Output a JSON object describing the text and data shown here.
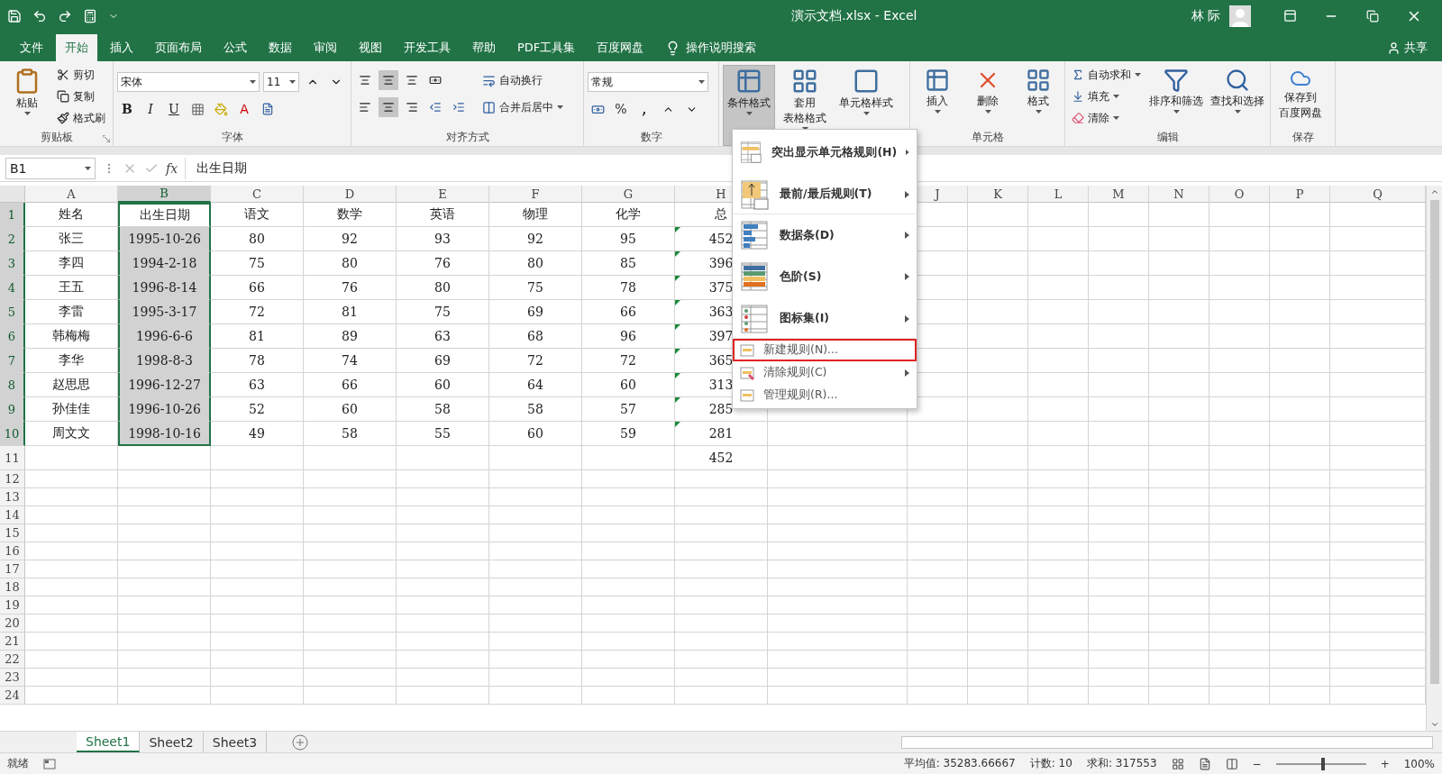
{
  "title_bar": {
    "title": "演示文档.xlsx  -  Excel",
    "user": "林 际"
  },
  "menu_tabs": [
    {
      "label": "文件",
      "selected": false
    },
    {
      "label": "开始",
      "selected": true
    },
    {
      "label": "插入",
      "selected": false
    },
    {
      "label": "页面布局",
      "selected": false
    },
    {
      "label": "公式",
      "selected": false
    },
    {
      "label": "数据",
      "selected": false
    },
    {
      "label": "审阅",
      "selected": false
    },
    {
      "label": "视图",
      "selected": false
    },
    {
      "label": "开发工具",
      "selected": false
    },
    {
      "label": "帮助",
      "selected": false
    },
    {
      "label": "PDF工具集",
      "selected": false
    },
    {
      "label": "百度网盘",
      "selected": false
    }
  ],
  "tell_me": "操作说明搜索",
  "share": "共享",
  "ribbon": {
    "clipboard": {
      "label": "剪贴板",
      "paste": "粘贴",
      "items": [
        "剪切",
        "复制",
        "格式刷"
      ]
    },
    "font": {
      "label": "字体",
      "font_name": "宋体",
      "font_size": "11",
      "bold": "B",
      "italic": "I",
      "underline": "U",
      "font_color": "A"
    },
    "alignment": {
      "label": "对齐方式",
      "wrap": "自动换行",
      "merge": "合并后居中"
    },
    "number": {
      "label": "数字",
      "format": "常规",
      "percent": "%",
      "comma": ","
    },
    "styles": {
      "buttons": [
        {
          "lines": [
            "条件格式"
          ],
          "selected": true
        },
        {
          "lines": [
            "套用",
            "表格格式"
          ],
          "selected": false
        },
        {
          "lines": [
            "单元格样式"
          ],
          "selected": false
        }
      ]
    },
    "cells": {
      "label": "单元格",
      "buttons": [
        "插入",
        "删除",
        "格式"
      ]
    },
    "editing": {
      "label": "编辑",
      "small": [
        "自动求和",
        "填充",
        "清除"
      ],
      "large": [
        "排序和筛选",
        "查找和选择"
      ]
    },
    "save": {
      "label": "保存",
      "button": [
        "保存到",
        "百度网盘"
      ]
    }
  },
  "formula_bar": {
    "name_box": "B1",
    "function_label": "fx",
    "formula": "出生日期"
  },
  "sheet": {
    "columns": [
      {
        "label": "A",
        "selected": false
      },
      {
        "label": "B",
        "selected": true
      },
      {
        "label": "C",
        "selected": false
      },
      {
        "label": "D",
        "selected": false
      },
      {
        "label": "E",
        "selected": false
      },
      {
        "label": "F",
        "selected": false
      },
      {
        "label": "G",
        "selected": false
      },
      {
        "label": "H",
        "selected": false
      },
      {},
      {
        "label": "J",
        "selected": false
      },
      {
        "label": "K",
        "selected": false
      },
      {
        "label": "L",
        "selected": false
      },
      {
        "label": "M",
        "selected": false
      },
      {
        "label": "N",
        "selected": false
      },
      {
        "label": "O",
        "selected": false
      },
      {
        "label": "P",
        "selected": false
      },
      {
        "label": "Q",
        "selected": false
      }
    ],
    "rows": [
      {
        "number": "1",
        "selected": true,
        "flagged": false,
        "cells": [
          "姓名",
          "出生日期",
          "语文",
          "数学",
          "英语",
          "物理",
          "化学",
          "总"
        ]
      },
      {
        "number": "2",
        "selected": true,
        "flagged": true,
        "cells": [
          "张三",
          "1995-10-26",
          "80",
          "92",
          "93",
          "92",
          "95",
          "452"
        ]
      },
      {
        "number": "3",
        "selected": true,
        "flagged": true,
        "cells": [
          "李四",
          "1994-2-18",
          "75",
          "80",
          "76",
          "80",
          "85",
          "396"
        ]
      },
      {
        "number": "4",
        "selected": true,
        "flagged": true,
        "cells": [
          "王五",
          "1996-8-14",
          "66",
          "76",
          "80",
          "75",
          "78",
          "375"
        ]
      },
      {
        "number": "5",
        "selected": true,
        "flagged": true,
        "cells": [
          "李雷",
          "1995-3-17",
          "72",
          "81",
          "75",
          "69",
          "66",
          "363"
        ]
      },
      {
        "number": "6",
        "selected": true,
        "flagged": true,
        "cells": [
          "韩梅梅",
          "1996-6-6",
          "81",
          "89",
          "63",
          "68",
          "96",
          "397"
        ]
      },
      {
        "number": "7",
        "selected": true,
        "flagged": true,
        "cells": [
          "李华",
          "1998-8-3",
          "78",
          "74",
          "69",
          "72",
          "72",
          "365"
        ]
      },
      {
        "number": "8",
        "selected": true,
        "flagged": true,
        "cells": [
          "赵思思",
          "1996-12-27",
          "63",
          "66",
          "60",
          "64",
          "60",
          "313"
        ]
      },
      {
        "number": "9",
        "selected": true,
        "flagged": true,
        "cells": [
          "孙佳佳",
          "1996-10-26",
          "52",
          "60",
          "58",
          "58",
          "57",
          "285"
        ]
      },
      {
        "number": "10",
        "selected": true,
        "flagged": true,
        "cells": [
          "周文文",
          "1998-10-16",
          "49",
          "58",
          "55",
          "60",
          "59",
          "281"
        ]
      },
      {
        "number": "11",
        "selected": false,
        "flagged": false,
        "cells": [
          null,
          null,
          null,
          null,
          null,
          null,
          null,
          "452"
        ]
      },
      {
        "number": "12",
        "selected": false,
        "flagged": false
      },
      {
        "number": "13",
        "selected": false,
        "flagged": false
      },
      {
        "number": "14",
        "selected": false,
        "flagged": false
      },
      {
        "number": "15",
        "selected": false,
        "flagged": false
      },
      {
        "number": "16",
        "selected": false,
        "flagged": false
      },
      {
        "number": "17",
        "selected": false,
        "flagged": false
      },
      {
        "number": "18",
        "selected": false,
        "flagged": false
      },
      {
        "number": "19",
        "selected": false,
        "flagged": false
      },
      {
        "number": "20",
        "selected": false,
        "flagged": false
      },
      {
        "number": "21",
        "selected": false,
        "flagged": false
      },
      {
        "number": "22",
        "selected": false,
        "flagged": false
      },
      {
        "number": "23",
        "selected": false,
        "flagged": false
      },
      {
        "number": "24",
        "selected": false,
        "flagged": false
      }
    ]
  },
  "dropdown_menu": [
    {
      "kind": "large",
      "label": "突出显示单元格规则(H)",
      "submenu": true,
      "selected": false
    },
    {
      "kind": "large",
      "label": "最前/最后规则(T)",
      "submenu": true,
      "selected": false
    },
    {
      "kind": "large",
      "label": "数据条(D)",
      "submenu": true,
      "selected": false
    },
    {
      "kind": "large",
      "label": "色阶(S)",
      "submenu": true,
      "selected": false
    },
    {
      "kind": "large",
      "label": "图标集(I)",
      "submenu": true,
      "selected": false
    },
    {
      "kind": "small",
      "label": "新建规则(N)...",
      "submenu": false,
      "selected": true
    },
    {
      "kind": "small",
      "label": "清除规则(C)",
      "submenu": true,
      "selected": false
    },
    {
      "kind": "small",
      "label": "管理规则(R)...",
      "submenu": false,
      "selected": false
    }
  ],
  "sheet_tabs": [
    {
      "label": "Sheet1",
      "selected": true
    },
    {
      "label": "Sheet2",
      "selected": false
    },
    {
      "label": "Sheet3",
      "selected": false
    }
  ],
  "status_bar": {
    "ready": "就绪",
    "average": "平均值: 35283.66667",
    "count": "计数: 10",
    "sum": "求和: 317553",
    "zoom_minus": "−",
    "zoom_plus": "+",
    "zoom": {
      "level": 0.52
    },
    "zoom_percent": "100%"
  }
}
